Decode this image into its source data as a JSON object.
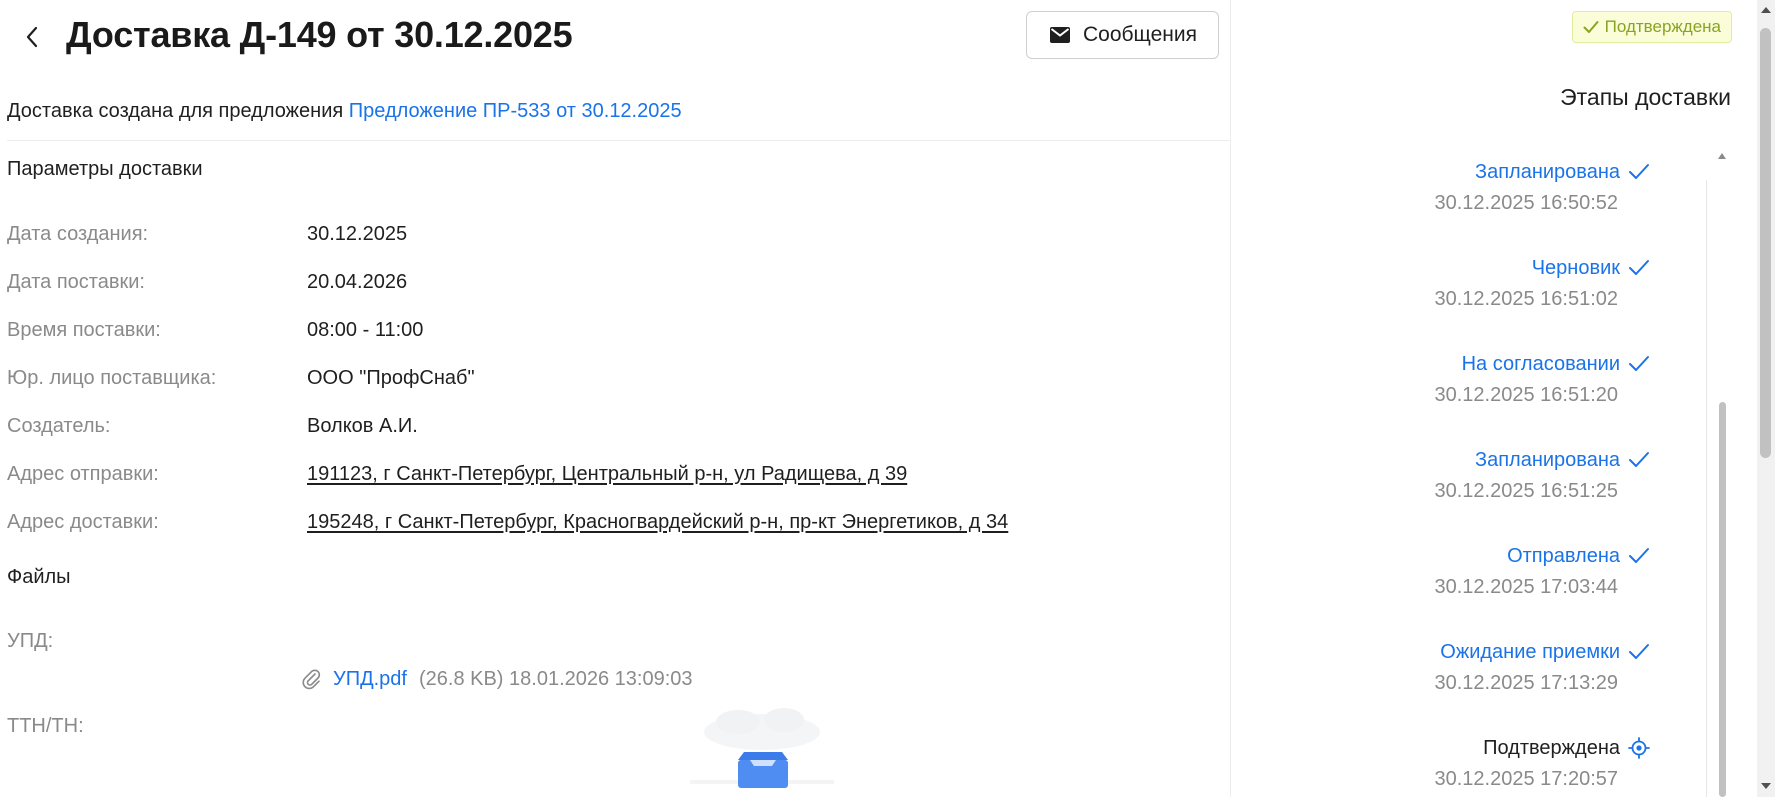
{
  "header": {
    "title": "Доставка Д-149 от 30.12.2025",
    "messages_button": "Сообщения",
    "messages_icon": "envelope-icon",
    "back_icon": "chevron-left-icon"
  },
  "created_for": {
    "prefix": "Доставка создана для предложения",
    "link": "Предложение ПР-533 от 30.12.2025"
  },
  "params": {
    "section_title": "Параметры доставки",
    "rows": [
      {
        "label": "Дата создания:",
        "value": "30.12.2025"
      },
      {
        "label": "Дата поставки:",
        "value": "20.04.2026"
      },
      {
        "label": "Время поставки:",
        "value": "08:00 - 11:00"
      },
      {
        "label": "Юр. лицо поставщика:",
        "value": "ООО \"ПрофСнаб\""
      },
      {
        "label": "Создатель:",
        "value": "Волков А.И."
      },
      {
        "label": "Адрес отправки:",
        "value": "191123, г Санкт-Петербург, Центральный р-н, ул Радищева, д 39"
      },
      {
        "label": "Адрес доставки:",
        "value": "195248, г Санкт-Петербург, Красногвардейский р-н, пр-кт Энергетиков, д 34"
      }
    ]
  },
  "files": {
    "section_title": "Файлы",
    "upd_label": "УПД:",
    "upd_file": {
      "name": "УПД.pdf",
      "meta": "(26.8 KB) 18.01.2026 13:09:03",
      "icon": "paperclip-icon"
    },
    "ttn_label": "ТТН/ТН:",
    "ttn_empty_icon": "empty-inbox-icon"
  },
  "sidebar": {
    "status_badge": "Подтверждена",
    "status_icon": "check-icon",
    "title": "Этапы доставки",
    "stages": [
      {
        "name": "Запланирована",
        "time": "30.12.2025 16:50:52",
        "done": true
      },
      {
        "name": "Черновик",
        "time": "30.12.2025 16:51:02",
        "done": true
      },
      {
        "name": "На согласовании",
        "time": "30.12.2025 16:51:20",
        "done": true
      },
      {
        "name": "Запланирована",
        "time": "30.12.2025 16:51:25",
        "done": true
      },
      {
        "name": "Отправлена",
        "time": "30.12.2025 17:03:44",
        "done": true
      },
      {
        "name": "Ожидание приемки",
        "time": "30.12.2025 17:13:29",
        "done": true
      },
      {
        "name": "Подтверждена",
        "time": "30.12.2025 17:20:57",
        "done": false
      }
    ]
  },
  "colors": {
    "link": "#1a73e8",
    "label": "#8a8a8a",
    "badge_bg": "#fafdd8",
    "badge_text": "#8aa322"
  }
}
